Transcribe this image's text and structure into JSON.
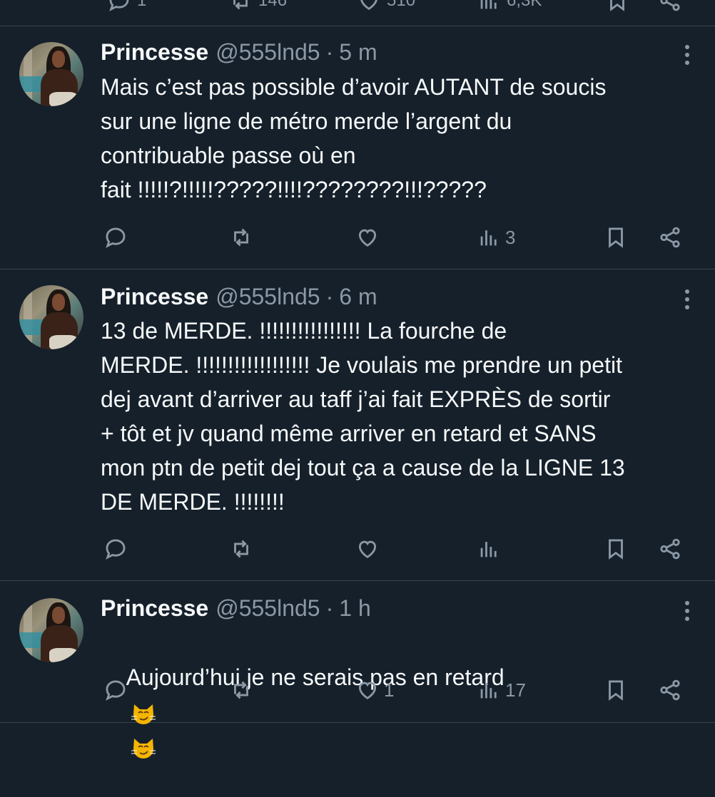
{
  "top_partial": {
    "reply_count": "1",
    "repost_count": "146",
    "like_count": "510",
    "view_count": "6,3K"
  },
  "tweets": [
    {
      "name": "Princesse",
      "handle": "@555lnd5",
      "separator": "·",
      "time": "5 m",
      "text": "Mais c’est pas possible d’avoir AUTANT de soucis\nsur une ligne de métro merde l’argent du\ncontribuable passe où en\nfait !!!!!?!!!!!?????!!!!????????!!!?????",
      "reply_count": "",
      "repost_count": "",
      "like_count": "",
      "view_count": "3"
    },
    {
      "name": "Princesse",
      "handle": "@555lnd5",
      "separator": "·",
      "time": "6 m",
      "text": "13 de MERDE. !!!!!!!!!!!!!!!! La fourche de\nMERDE. !!!!!!!!!!!!!!!!!! Je voulais me prendre un petit\ndej avant d’arriver au taff j’ai fait EXPRÈS de sortir\n+ tôt et jv quand même arriver en retard et SANS\nmon ptn de petit dej tout ça a cause de la LIGNE 13\nDE MERDE. !!!!!!!!",
      "reply_count": "",
      "repost_count": "",
      "like_count": "",
      "view_count": ""
    },
    {
      "name": "Princesse",
      "handle": "@555lnd5",
      "separator": "·",
      "time": "1 h",
      "text": "Aujourd’hui je ne serais pas en retard",
      "emoji": "smirking-cat-face",
      "reply_count": "",
      "repost_count": "",
      "like_count": "1",
      "view_count": "17"
    }
  ],
  "colors": {
    "background": "#15202b",
    "divider": "#38444d",
    "primary_text": "#f7f9f9",
    "secondary_text": "#8b98a5"
  }
}
